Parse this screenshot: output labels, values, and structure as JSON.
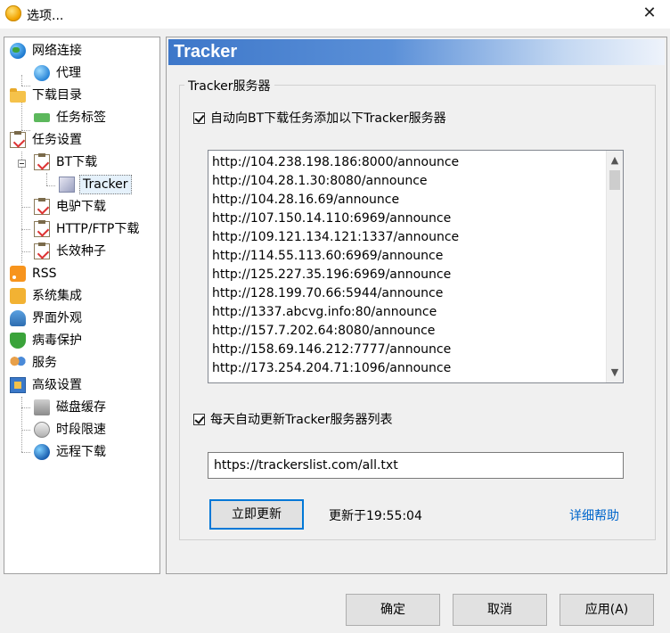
{
  "window": {
    "title": "选项...",
    "close_glyph": "✕"
  },
  "tree": {
    "items": [
      {
        "label": "网络连接",
        "icon": "globe-network-icon"
      },
      {
        "label": "代理",
        "icon": "proxy-globe-icon"
      },
      {
        "label": "下载目录",
        "icon": "folder-icon"
      },
      {
        "label": "任务标签",
        "icon": "tag-icon"
      },
      {
        "label": "任务设置",
        "icon": "clipboard-icon"
      },
      {
        "label": "BT下载",
        "icon": "clipboard-icon"
      },
      {
        "label": "Tracker",
        "icon": "cube-icon"
      },
      {
        "label": "电驴下载",
        "icon": "clipboard-icon"
      },
      {
        "label": "HTTP/FTP下载",
        "icon": "clipboard-icon"
      },
      {
        "label": "长效种子",
        "icon": "clipboard-icon"
      },
      {
        "label": "RSS",
        "icon": "rss-icon"
      },
      {
        "label": "系统集成",
        "icon": "puzzle-icon"
      },
      {
        "label": "界面外观",
        "icon": "person-icon"
      },
      {
        "label": "病毒保护",
        "icon": "shield-icon"
      },
      {
        "label": "服务",
        "icon": "service-icon"
      },
      {
        "label": "高级设置",
        "icon": "advanced-settings-icon"
      },
      {
        "label": "磁盘缓存",
        "icon": "disk-cache-icon"
      },
      {
        "label": "时段限速",
        "icon": "time-limit-icon"
      },
      {
        "label": "远程下载",
        "icon": "remote-download-icon"
      }
    ],
    "selected": "Tracker"
  },
  "panel": {
    "header": "Tracker",
    "group_title": "Tracker服务器",
    "auto_add_checkbox": {
      "label": "自动向BT下载任务添加以下Tracker服务器",
      "checked": true
    },
    "tracker_list": [
      "http://104.238.198.186:8000/announce",
      "http://104.28.1.30:8080/announce",
      "http://104.28.16.69/announce",
      "http://107.150.14.110:6969/announce",
      "http://109.121.134.121:1337/announce",
      "http://114.55.113.60:6969/announce",
      "http://125.227.35.196:6969/announce",
      "http://128.199.70.66:5944/announce",
      "http://1337.abcvg.info:80/announce",
      "http://157.7.202.64:8080/announce",
      "http://158.69.146.212:7777/announce",
      "http://173.254.204.71:1096/announce"
    ],
    "auto_update_checkbox": {
      "label": "每天自动更新Tracker服务器列表",
      "checked": true
    },
    "url_value": "https://trackerslist.com/all.txt",
    "update_now_button": "立即更新",
    "update_status": "更新于19:55:04",
    "help_link": "详细帮助"
  },
  "footer": {
    "ok": "确定",
    "cancel": "取消",
    "apply": "应用(A)"
  },
  "colors": {
    "link": "#0066cc",
    "header_start": "#3d77c9",
    "selection": "#e5f1fb"
  }
}
